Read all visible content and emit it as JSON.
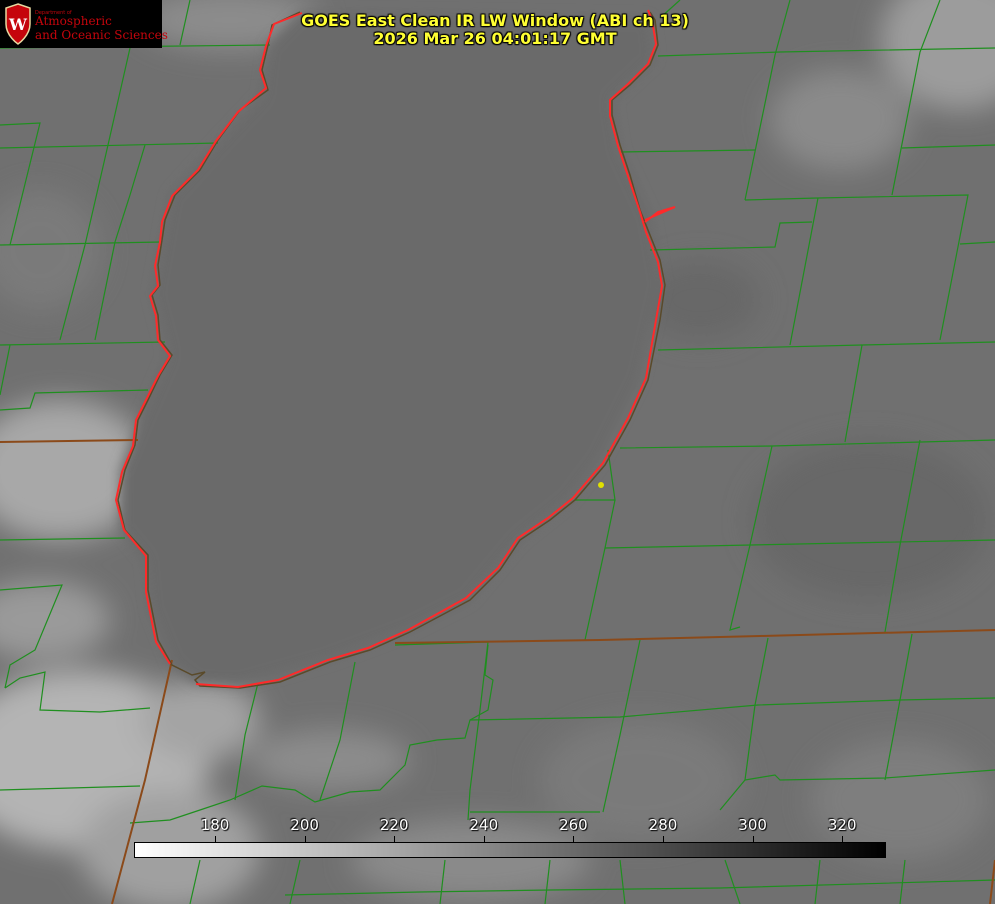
{
  "title": {
    "line1": "GOES East Clean IR LW Window (ABI ch 13)",
    "line2": "2026 Mar 26 04:01:17 GMT"
  },
  "logo": {
    "dept": "Department of",
    "line1": "Atmospheric",
    "line2": "and Oceanic Sciences"
  },
  "colorbar": {
    "ticks": [
      "180",
      "200",
      "220",
      "240",
      "260",
      "280",
      "300",
      "320"
    ],
    "gradient_from": "#ffffff",
    "gradient_to": "#000000"
  },
  "colors": {
    "county_lines": "#1f8f1f",
    "lake_shoreline": "#ff2a2a",
    "state_border": "#8b4a1a",
    "marker": "#e0e000"
  }
}
